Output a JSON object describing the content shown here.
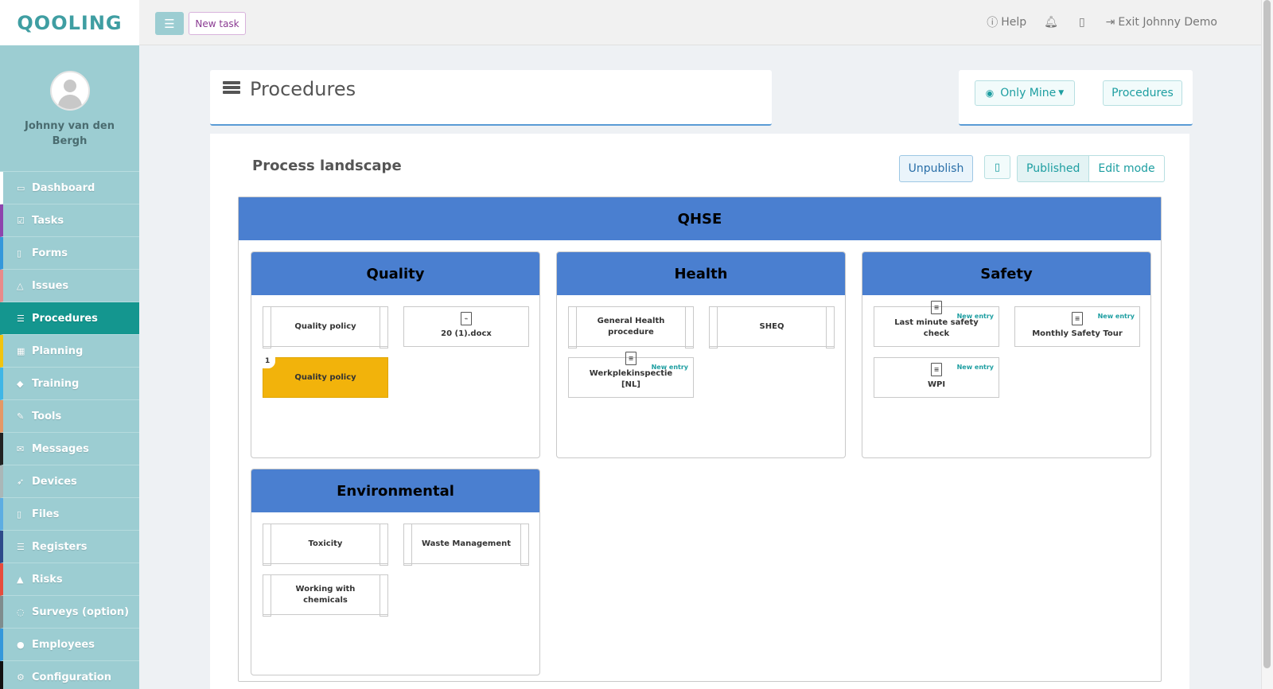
{
  "app": {
    "logo": "QOOLING"
  },
  "profile": {
    "name": "Johnny van den Bergh"
  },
  "sidebar": {
    "items": [
      {
        "label": "Dashboard",
        "icon": "monitor-icon",
        "color": "#ffffff"
      },
      {
        "label": "Tasks",
        "icon": "checkbox-icon",
        "color": "#8e44ad"
      },
      {
        "label": "Forms",
        "icon": "file-icon",
        "color": "#3498db"
      },
      {
        "label": "Issues",
        "icon": "bell-icon",
        "color": "#e88a8a"
      },
      {
        "label": "Procedures",
        "icon": "list-icon",
        "color": "#14968f"
      },
      {
        "label": "Planning",
        "icon": "calendar-icon",
        "color": "#f1c40f"
      },
      {
        "label": "Training",
        "icon": "graduation-icon",
        "color": "#3fb6e6"
      },
      {
        "label": "Tools",
        "icon": "wrench-icon",
        "color": "#e59866"
      },
      {
        "label": "Messages",
        "icon": "envelope-icon",
        "color": "#222222"
      },
      {
        "label": "Devices",
        "icon": "rocket-icon",
        "color": "#aab7b8"
      },
      {
        "label": "Files",
        "icon": "document-icon",
        "color": "#5dade2"
      },
      {
        "label": "Registers",
        "icon": "list-icon",
        "color": "#2e4a8a"
      },
      {
        "label": "Risks",
        "icon": "warning-icon",
        "color": "#e74c3c"
      },
      {
        "label": "Surveys (option)",
        "icon": "comment-icon",
        "color": "#7f8c8d"
      },
      {
        "label": "Employees",
        "icon": "users-icon",
        "color": "#3498db"
      },
      {
        "label": "Configuration",
        "icon": "gear-icon",
        "color": "#111111"
      }
    ],
    "active": "Procedures"
  },
  "topbar": {
    "new_task": "New task",
    "help": "Help",
    "exit": "Exit Johnny Demo"
  },
  "page": {
    "title": "Procedures",
    "only_mine": "Only Mine",
    "procedures_btn": "Procedures"
  },
  "landscape": {
    "title": "Process landscape",
    "unpublish": "Unpublish",
    "published": "Published",
    "edit_mode": "Edit mode",
    "root": "QHSE",
    "groups": {
      "quality": {
        "title": "Quality",
        "tiles": [
          "Quality policy",
          "20 (1).docx",
          "Quality policy"
        ],
        "badge": "1"
      },
      "health": {
        "title": "Health",
        "tiles": [
          "General Health procedure",
          "SHEQ",
          "Werkplekinspectie [NL]"
        ]
      },
      "safety": {
        "title": "Safety",
        "tiles": [
          "Last minute safety check",
          "Monthly Safety Tour",
          "WPI"
        ]
      },
      "environmental": {
        "title": "Environmental",
        "tiles": [
          "Toxicity",
          "Waste Management",
          "Working with chemicals"
        ]
      }
    },
    "new_entry": "New entry",
    "colors": {
      "header_blue": "#4a7fd0",
      "highlight": "#f2b30b",
      "accent": "#1d9ea1"
    }
  }
}
